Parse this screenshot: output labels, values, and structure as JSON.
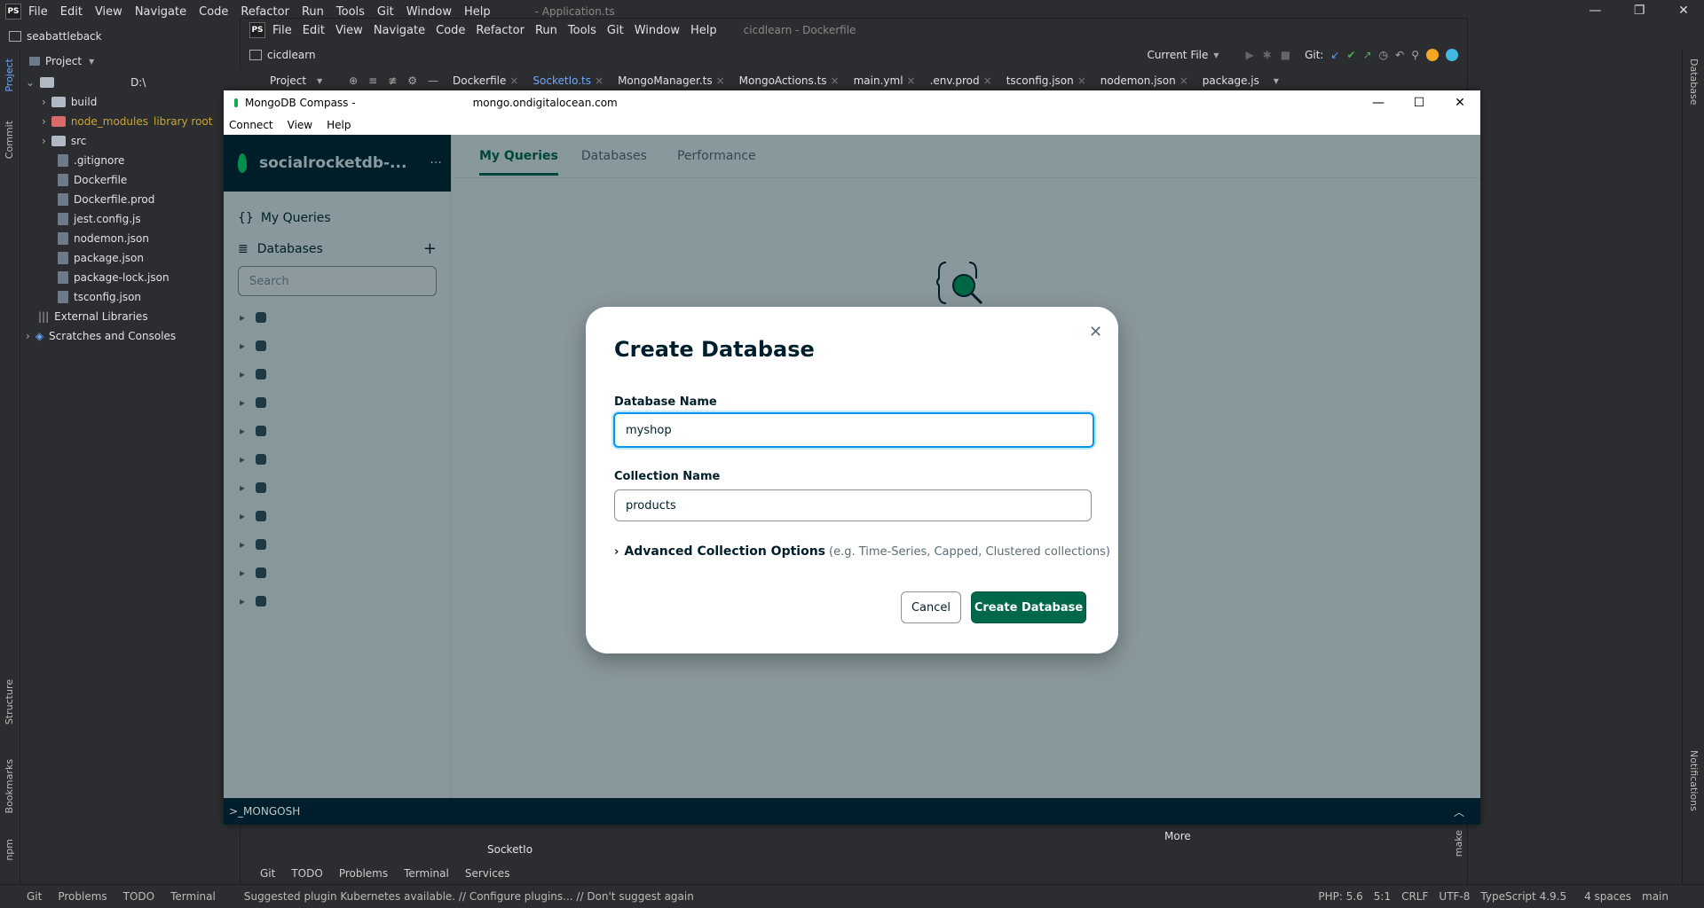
{
  "ide": {
    "menu": [
      "File",
      "Edit",
      "View",
      "Navigate",
      "Code",
      "Refactor",
      "Run",
      "Tools",
      "Git",
      "Window",
      "Help"
    ],
    "window_title": "- Application.ts",
    "project_name": "seabattleback",
    "project_label": "Project",
    "tree": {
      "root": "D:\\",
      "items": [
        {
          "label": "build",
          "type": "folder"
        },
        {
          "label": "node_modules",
          "suffix": "library root",
          "type": "folder-excluded"
        },
        {
          "label": "src",
          "type": "folder"
        },
        {
          "label": ".gitignore",
          "type": "file"
        },
        {
          "label": "Dockerfile",
          "type": "file"
        },
        {
          "label": "Dockerfile.prod",
          "type": "file"
        },
        {
          "label": "jest.config.js",
          "type": "file"
        },
        {
          "label": "nodemon.json",
          "type": "file"
        },
        {
          "label": "package.json",
          "type": "file"
        },
        {
          "label": "package-lock.json",
          "type": "file"
        },
        {
          "label": "tsconfig.json",
          "type": "file"
        }
      ],
      "external": "External Libraries",
      "scratches": "Scratches and Consoles"
    },
    "left_strip": {
      "project": "Project",
      "commit": "Commit",
      "structure": "Structure",
      "bookmarks": "Bookmarks",
      "npm": "npm"
    },
    "right_strip": {
      "database": "Database",
      "notifications": "Notifications"
    },
    "status_left": [
      "Git",
      "Problems",
      "TODO",
      "Terminal"
    ],
    "status_message": "Suggested plugin Kubernetes available. // Configure plugins... // Don't suggest again",
    "status_right": [
      "PHP: 5.6",
      "5:1",
      "CRLF",
      "UTF-8",
      "TypeScript 4.9.5",
      "4 spaces",
      "main"
    ]
  },
  "ide2": {
    "menu": [
      "File",
      "Edit",
      "View",
      "Navigate",
      "Code",
      "Refactor",
      "Run",
      "Tools",
      "Git",
      "Window",
      "Help"
    ],
    "title": "cicdlearn - Dockerfile",
    "breadcrumb": "cicdlearn",
    "run_config": "Current File",
    "git_label": "Git:",
    "project_label": "Project",
    "tabs": [
      "Dockerfile",
      "SocketIo.ts",
      "MongoManager.ts",
      "MongoActions.ts",
      "main.yml",
      ".env.prod",
      "tsconfig.json",
      "nodemon.json",
      "package.js"
    ],
    "tool_tabs": [
      "Git",
      "TODO",
      "Problems",
      "Terminal",
      "Services"
    ],
    "socketio_label": "SocketIo",
    "more_label": "More",
    "make_label": "make"
  },
  "compass": {
    "title_prefix": "MongoDB Compass -",
    "title_host": "mongo.ondigitalocean.com",
    "menu": [
      "Connect",
      "View",
      "Help"
    ],
    "connection_name": "socialrocketdb-...",
    "nav": {
      "queries": "My Queries",
      "databases": "Databases"
    },
    "search_placeholder": "Search",
    "tabs": [
      "My Queries",
      "Databases",
      "Performance"
    ],
    "mongosh": ">_MONGOSH",
    "db_count": 11
  },
  "modal": {
    "title": "Create Database",
    "db_name_label": "Database Name",
    "db_name_value": "myshop",
    "collection_label": "Collection Name",
    "collection_value": "products",
    "advanced_label": "Advanced Collection Options",
    "advanced_hint": "(e.g. Time-Series, Capped, Clustered collections)",
    "cancel": "Cancel",
    "create": "Create Database"
  },
  "colors": {
    "mongo_green": "#00684a",
    "ide_bg": "#2b2d30",
    "compass_dark": "#001e2b",
    "focus_blue": "#0498ec"
  }
}
